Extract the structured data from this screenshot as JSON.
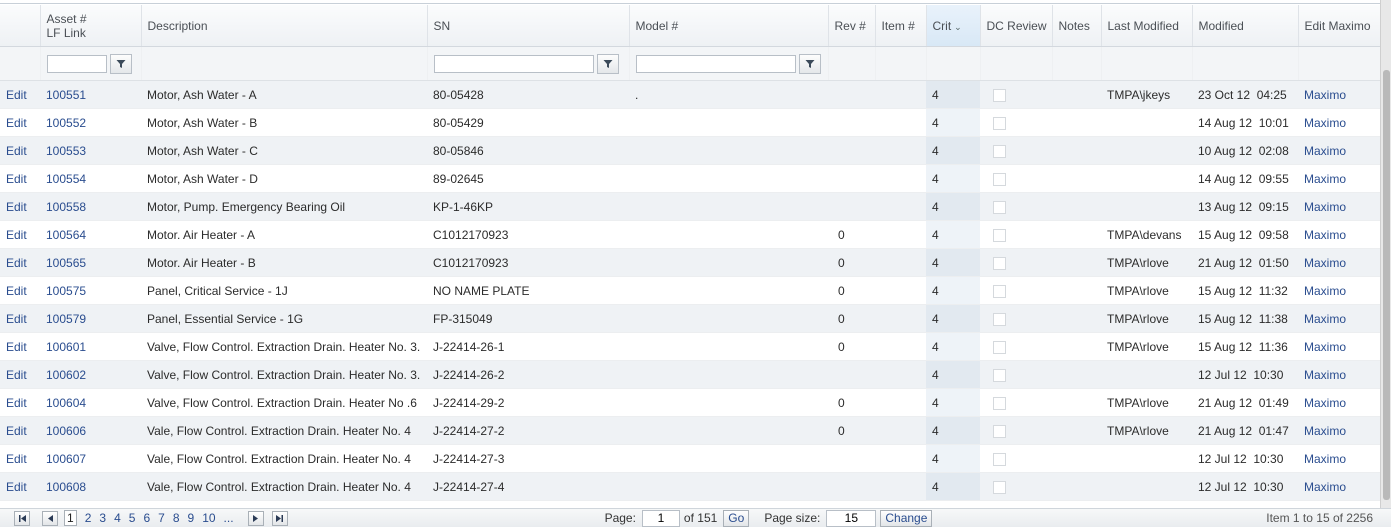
{
  "columns": {
    "asset_line1": "Asset #",
    "asset_line2": "LF Link",
    "description": "Description",
    "sn": "SN",
    "model": "Model #",
    "rev": "Rev #",
    "item": "Item #",
    "crit": "Crit",
    "dc_review": "DC Review",
    "notes": "Notes",
    "last_modified": "Last Modified",
    "modified": "Modified",
    "edit_maximo": "Edit Maximo"
  },
  "filters": {
    "asset": "",
    "sn": "",
    "model": ""
  },
  "rows": [
    {
      "edit": "Edit",
      "asset": "100551",
      "description": "Motor, Ash Water - A",
      "sn": "80-05428",
      "model": ".",
      "rev": "",
      "item": "",
      "crit": "4",
      "notes": "",
      "last_modified": "TMPA\\jkeys",
      "modified": "23 Oct 12  04:25",
      "maximo": "Maximo"
    },
    {
      "edit": "Edit",
      "asset": "100552",
      "description": "Motor, Ash Water - B",
      "sn": "80-05429",
      "model": "",
      "rev": "",
      "item": "",
      "crit": "4",
      "notes": "",
      "last_modified": "",
      "modified": "14 Aug 12  10:01",
      "maximo": "Maximo"
    },
    {
      "edit": "Edit",
      "asset": "100553",
      "description": "Motor, Ash Water - C",
      "sn": "80-05846",
      "model": "",
      "rev": "",
      "item": "",
      "crit": "4",
      "notes": "",
      "last_modified": "",
      "modified": "10 Aug 12  02:08",
      "maximo": "Maximo"
    },
    {
      "edit": "Edit",
      "asset": "100554",
      "description": "Motor, Ash Water - D",
      "sn": "89-02645",
      "model": "",
      "rev": "",
      "item": "",
      "crit": "4",
      "notes": "",
      "last_modified": "",
      "modified": "14 Aug 12  09:55",
      "maximo": "Maximo"
    },
    {
      "edit": "Edit",
      "asset": "100558",
      "description": "Motor, Pump. Emergency Bearing Oil",
      "sn": "KP-1-46KP",
      "model": "",
      "rev": "",
      "item": "",
      "crit": "4",
      "notes": "",
      "last_modified": "",
      "modified": "13 Aug 12  09:15",
      "maximo": "Maximo"
    },
    {
      "edit": "Edit",
      "asset": "100564",
      "description": "Motor. Air Heater - A",
      "sn": "C1012170923",
      "model": "",
      "rev": "0",
      "item": "",
      "crit": "4",
      "notes": "",
      "last_modified": "TMPA\\devans",
      "modified": "15 Aug 12  09:58",
      "maximo": "Maximo"
    },
    {
      "edit": "Edit",
      "asset": "100565",
      "description": "Motor. Air Heater - B",
      "sn": "C1012170923",
      "model": "",
      "rev": "0",
      "item": "",
      "crit": "4",
      "notes": "",
      "last_modified": "TMPA\\rlove",
      "modified": "21 Aug 12  01:50",
      "maximo": "Maximo"
    },
    {
      "edit": "Edit",
      "asset": "100575",
      "description": "Panel, Critical Service - 1J",
      "sn": "NO NAME PLATE",
      "model": "",
      "rev": "0",
      "item": "",
      "crit": "4",
      "notes": "",
      "last_modified": "TMPA\\rlove",
      "modified": "15 Aug 12  11:32",
      "maximo": "Maximo"
    },
    {
      "edit": "Edit",
      "asset": "100579",
      "description": "Panel, Essential Service - 1G",
      "sn": "FP-315049",
      "model": "",
      "rev": "0",
      "item": "",
      "crit": "4",
      "notes": "",
      "last_modified": "TMPA\\rlove",
      "modified": "15 Aug 12  11:38",
      "maximo": "Maximo"
    },
    {
      "edit": "Edit",
      "asset": "100601",
      "description": "Valve, Flow Control. Extraction Drain. Heater No. 3.",
      "sn": "J-22414-26-1",
      "model": "",
      "rev": "0",
      "item": "",
      "crit": "4",
      "notes": "",
      "last_modified": "TMPA\\rlove",
      "modified": "15 Aug 12  11:36",
      "maximo": "Maximo"
    },
    {
      "edit": "Edit",
      "asset": "100602",
      "description": "Valve, Flow Control. Extraction Drain. Heater No. 3.",
      "sn": "J-22414-26-2",
      "model": "",
      "rev": "",
      "item": "",
      "crit": "4",
      "notes": "",
      "last_modified": "",
      "modified": "12 Jul 12  10:30",
      "maximo": "Maximo"
    },
    {
      "edit": "Edit",
      "asset": "100604",
      "description": "Valve, Flow Control. Extraction Drain. Heater No .6",
      "sn": "J-22414-29-2",
      "model": "",
      "rev": "0",
      "item": "",
      "crit": "4",
      "notes": "",
      "last_modified": "TMPA\\rlove",
      "modified": "21 Aug 12  01:49",
      "maximo": "Maximo"
    },
    {
      "edit": "Edit",
      "asset": "100606",
      "description": "Vale, Flow Control. Extraction Drain. Heater No. 4",
      "sn": "J-22414-27-2",
      "model": "",
      "rev": "0",
      "item": "",
      "crit": "4",
      "notes": "",
      "last_modified": "TMPA\\rlove",
      "modified": "21 Aug 12  01:47",
      "maximo": "Maximo"
    },
    {
      "edit": "Edit",
      "asset": "100607",
      "description": "Vale, Flow Control. Extraction Drain. Heater No. 4",
      "sn": "J-22414-27-3",
      "model": "",
      "rev": "",
      "item": "",
      "crit": "4",
      "notes": "",
      "last_modified": "",
      "modified": "12 Jul 12  10:30",
      "maximo": "Maximo"
    },
    {
      "edit": "Edit",
      "asset": "100608",
      "description": "Vale, Flow Control. Extraction Drain. Heater No. 4",
      "sn": "J-22414-27-4",
      "model": "",
      "rev": "",
      "item": "",
      "crit": "4",
      "notes": "",
      "last_modified": "",
      "modified": "12 Jul 12  10:30",
      "maximo": "Maximo"
    }
  ],
  "pager": {
    "pages": [
      "1",
      "2",
      "3",
      "4",
      "5",
      "6",
      "7",
      "8",
      "9",
      "10",
      "..."
    ],
    "current_page": "1",
    "page_label": "Page:",
    "page_value": "1",
    "of_label": "of 151",
    "go_label": "Go",
    "page_size_label": "Page size:",
    "page_size_value": "15",
    "change_label": "Change",
    "summary": "Item 1 to 15 of 2256"
  },
  "icons": {
    "filter": "filter-funnel-icon",
    "first": "first-page-icon",
    "prev": "previous-page-icon",
    "next": "next-page-icon",
    "last": "last-page-icon",
    "sort": "sort-descending-icon"
  }
}
